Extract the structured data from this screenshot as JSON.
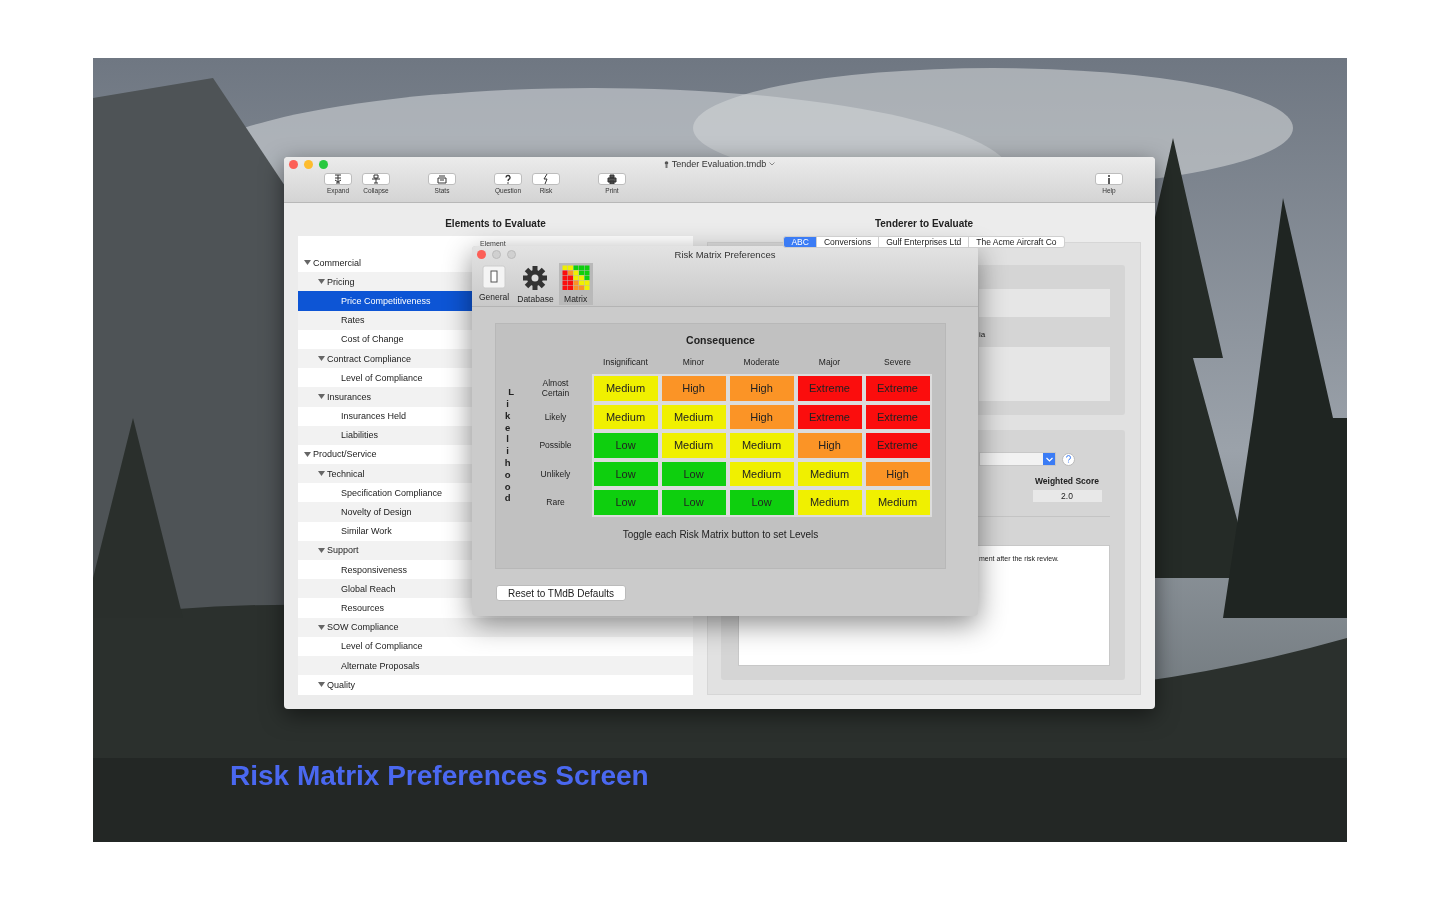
{
  "window": {
    "title": "Tender Evaluation.tmdb"
  },
  "toolbar": [
    {
      "kind": "expand",
      "label": "Expand"
    },
    {
      "kind": "collapse",
      "label": "Collapse"
    },
    {
      "kind": "stats",
      "label": "Stats"
    },
    {
      "kind": "question",
      "label": "Question"
    },
    {
      "kind": "risk",
      "label": "Risk"
    },
    {
      "kind": "print",
      "label": "Print"
    },
    {
      "kind": "help",
      "label": "Help"
    }
  ],
  "elements": {
    "title": "Elements to Evaluate",
    "column": "Element",
    "tree": [
      {
        "label": "Commercial",
        "selected": false,
        "expanded": true,
        "children": [
          {
            "label": "Pricing",
            "selected": false,
            "expanded": true,
            "children": [
              {
                "label": "Price Competitiveness",
                "selected": true
              },
              {
                "label": "Rates",
                "selected": false
              },
              {
                "label": "Cost of Change",
                "selected": false
              }
            ]
          },
          {
            "label": "Contract Compliance",
            "selected": false,
            "expanded": true,
            "children": [
              {
                "label": "Level of Compliance",
                "selected": false
              }
            ]
          },
          {
            "label": "Insurances",
            "selected": false,
            "expanded": true,
            "children": [
              {
                "label": "Insurances Held",
                "selected": false
              },
              {
                "label": "Liabilities",
                "selected": false
              }
            ]
          }
        ]
      },
      {
        "label": "Product/Service",
        "selected": false,
        "expanded": true,
        "children": [
          {
            "label": "Technical",
            "selected": false,
            "expanded": true,
            "children": [
              {
                "label": "Specification Compliance",
                "selected": false
              },
              {
                "label": "Novelty of Design",
                "selected": false
              },
              {
                "label": "Similar Work",
                "selected": false
              }
            ]
          },
          {
            "label": "Support",
            "selected": false,
            "expanded": true,
            "children": [
              {
                "label": "Responsiveness",
                "selected": false
              },
              {
                "label": "Global Reach",
                "selected": false
              },
              {
                "label": "Resources",
                "selected": false
              }
            ]
          },
          {
            "label": "SOW Compliance",
            "selected": false,
            "expanded": true,
            "children": [
              {
                "label": "Level of Compliance",
                "selected": false
              },
              {
                "label": "Alternate Proposals",
                "selected": false
              }
            ]
          },
          {
            "label": "Quality",
            "selected": false,
            "expanded": true
          }
        ]
      }
    ]
  },
  "tenderers": {
    "title": "Tenderer to Evaluate",
    "tabs": [
      {
        "label": "ABC",
        "selected": true
      },
      {
        "label": "Conversions",
        "selected": false
      },
      {
        "label": "Gulf Enterprises Ltd",
        "selected": false
      },
      {
        "label": "The Acme Aircraft Co",
        "selected": false
      }
    ],
    "fragment_label": "ia",
    "score_label": "Weighted Score",
    "score_value": "2.0",
    "notes_text": "ment after the risk review."
  },
  "dialog": {
    "title": "Risk Matrix Preferences",
    "tabs": [
      {
        "kind": "general",
        "label": "General",
        "selected": false
      },
      {
        "kind": "database",
        "label": "Database",
        "selected": false
      },
      {
        "kind": "matrix",
        "label": "Matrix",
        "selected": true
      }
    ],
    "heading": "Consequence",
    "axis_label": "Likelihood",
    "columns": [
      "Insignificant",
      "Minor",
      "Moderate",
      "Major",
      "Severe"
    ],
    "rows": [
      {
        "label": "Almost Certain",
        "cells": [
          {
            "label": "Medium",
            "color": "#f0f000"
          },
          {
            "label": "High",
            "color": "#fb9426"
          },
          {
            "label": "High",
            "color": "#fb9426"
          },
          {
            "label": "Extreme",
            "color": "#fb0d0d"
          },
          {
            "label": "Extreme",
            "color": "#fb0d0d"
          }
        ]
      },
      {
        "label": "Likely",
        "cells": [
          {
            "label": "Medium",
            "color": "#f0f000"
          },
          {
            "label": "Medium",
            "color": "#f0f000"
          },
          {
            "label": "High",
            "color": "#fb9426"
          },
          {
            "label": "Extreme",
            "color": "#fb0d0d"
          },
          {
            "label": "Extreme",
            "color": "#fb0d0d"
          }
        ]
      },
      {
        "label": "Possible",
        "cells": [
          {
            "label": "Low",
            "color": "#0ecf0e"
          },
          {
            "label": "Medium",
            "color": "#f0f000"
          },
          {
            "label": "Medium",
            "color": "#f0f000"
          },
          {
            "label": "High",
            "color": "#fb9426"
          },
          {
            "label": "Extreme",
            "color": "#fb0d0d"
          }
        ]
      },
      {
        "label": "Unlikely",
        "cells": [
          {
            "label": "Low",
            "color": "#0ecf0e"
          },
          {
            "label": "Low",
            "color": "#0ecf0e"
          },
          {
            "label": "Medium",
            "color": "#f0f000"
          },
          {
            "label": "Medium",
            "color": "#f0f000"
          },
          {
            "label": "High",
            "color": "#fb9426"
          }
        ]
      },
      {
        "label": "Rare",
        "cells": [
          {
            "label": "Low",
            "color": "#0ecf0e"
          },
          {
            "label": "Low",
            "color": "#0ecf0e"
          },
          {
            "label": "Low",
            "color": "#0ecf0e"
          },
          {
            "label": "Medium",
            "color": "#f0f000"
          },
          {
            "label": "Medium",
            "color": "#f0f000"
          }
        ]
      }
    ],
    "hint": "Toggle each Risk Matrix button to set Levels",
    "reset_button": "Reset to TMdB Defaults"
  },
  "caption": "Risk Matrix Preferences Screen"
}
